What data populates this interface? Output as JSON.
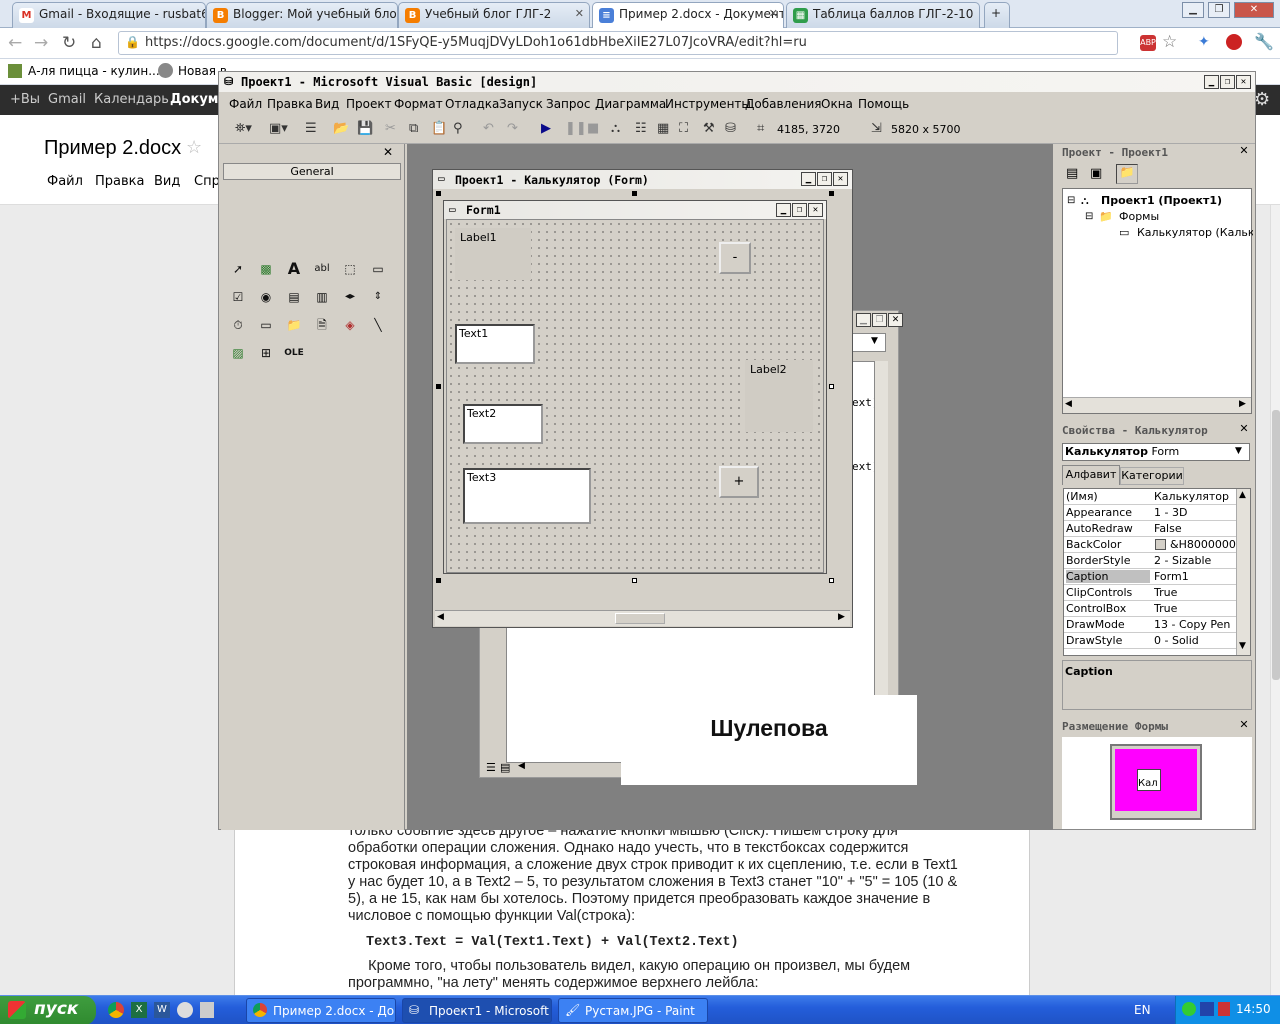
{
  "browser": {
    "tabs": [
      {
        "label": "Gmail - Входящие - rusbat6",
        "icon": "gmail-icon",
        "color": "#d93025"
      },
      {
        "label": "Blogger: Мой учебный блог",
        "icon": "blogger-icon",
        "color": "#f57d00"
      },
      {
        "label": "Учебный блог ГЛГ-2",
        "icon": "blogger-icon",
        "color": "#f57d00"
      },
      {
        "label": "Пример 2.docx - Документ",
        "icon": "docs-icon",
        "color": "#4a7fd8"
      },
      {
        "label": "Таблица баллов ГЛГ-2-10",
        "icon": "sheets-icon",
        "color": "#2f9d4b"
      }
    ],
    "url": "https://docs.google.com/document/d/1SFyQE-y5MuqjDVyLDoh1o61dbHbeXiIE27L07JcoVRA/edit?hl=ru",
    "bookmarks": [
      "А-ля пицца - кулин...",
      "Новая в"
    ]
  },
  "gbar": {
    "items": [
      "+Вы",
      "Gmail",
      "Календарь",
      "Докуме"
    ]
  },
  "docs": {
    "title": "Пример 2.docx",
    "menu": [
      "Файл",
      "Правка",
      "Вид",
      "Спр"
    ],
    "lines": [
      "только событие здесь другое – нажатие кнопки мышью (Click). Пишем строку для",
      "обработки операции сложения. Однако надо учесть, что в текстбоксах содержится",
      "строковая информация, а сложение двух строк приводит к их сцеплению, т.е. если в Text1",
      "у нас будет 10, а в Text2 – 5, то результатом сложения в Text3 станет \"10\" + \"5\" = 105 (10 &",
      "5), а не 15, как нам бы хотелось. Поэтому придется преобразовать каждое значение в",
      "числовое с помощью  функции Val(строка):"
    ],
    "code": "Text3.Text = Val(Text1.Text) + Val(Text2.Text)",
    "lines2": [
      "     Кроме того, чтобы пользователь видел, какую операцию он произвел, мы будем",
      "программно, \"на лету\" менять содержимое верхнего лейбла:"
    ]
  },
  "vb": {
    "title": "Проект1 - Microsoft Visual Basic [design]",
    "menu": [
      "Файл",
      "Правка",
      "Вид",
      "Проект",
      "Формат",
      "Отладка",
      "Запуск",
      "Запрос",
      "Диаграмма",
      "Инструменты",
      "Добавления",
      "Окна",
      "Помощь"
    ],
    "position": "4185, 3720",
    "size": "5820 x 5700",
    "toolbox_title": "General",
    "form_designer_title": "Проект1 - Калькулятор (Form)",
    "form": {
      "caption": "Form1",
      "label1": "Label1",
      "label2": "Label2",
      "text1": "Text1",
      "text2": "Text2",
      "text3": "Text3",
      "btn_minus": "-",
      "btn_plus": "+"
    },
    "code_fragments": [
      "ext)",
      "ext)"
    ],
    "project": {
      "title": "Проект - Проект1",
      "root": "Проект1 (Проект1)",
      "folder": "Формы",
      "item": "Калькулятор (Кальку."
    },
    "properties": {
      "title": "Свойства - Калькулятор",
      "object": "Калькулятор",
      "object_type": "Form",
      "tabs": [
        "Алфавит",
        "Категории"
      ],
      "rows": [
        {
          "name": "(Имя)",
          "value": "Калькулятор"
        },
        {
          "name": "Appearance",
          "value": "1 - 3D"
        },
        {
          "name": "AutoRedraw",
          "value": "False"
        },
        {
          "name": "BackColor",
          "value": "&H8000000F"
        },
        {
          "name": "BorderStyle",
          "value": "2 - Sizable"
        },
        {
          "name": "Caption",
          "value": "Form1"
        },
        {
          "name": "ClipControls",
          "value": "True"
        },
        {
          "name": "ControlBox",
          "value": "True"
        },
        {
          "name": "DrawMode",
          "value": "13 - Copy Pen"
        },
        {
          "name": "DrawStyle",
          "value": "0 - Solid"
        }
      ],
      "description": "Caption"
    },
    "layout_panel": {
      "title": "Размещение Формы",
      "preview_label": "Кал"
    }
  },
  "overlay": {
    "name": "Шулепова"
  },
  "taskbar": {
    "start": "пуск",
    "buttons": [
      "Пример 2.docx - Док...",
      "Проект1 - Microsoft ...",
      "Рустам.JPG - Paint"
    ],
    "lang": "EN",
    "time": "14:50"
  },
  "colors": {
    "form_layout_preview": "#ff00ff",
    "gbar": "#2d2d2d",
    "taskbar": "#245edb"
  }
}
